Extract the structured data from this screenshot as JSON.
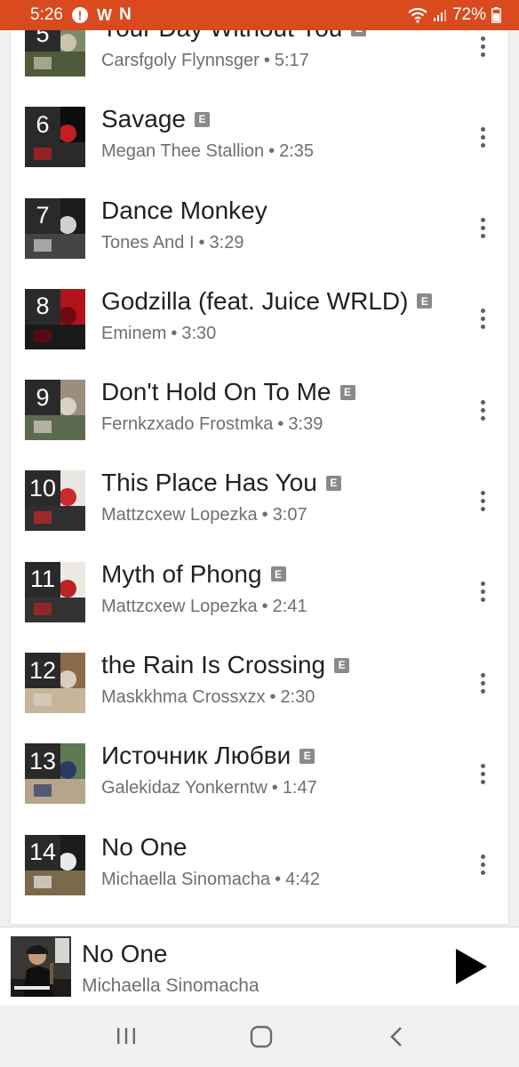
{
  "status_bar": {
    "time": "5:26",
    "battery": "72%",
    "icons": [
      "alert-icon",
      "w-icon",
      "n-icon",
      "wifi-icon",
      "signal-icon",
      "battery-icon"
    ]
  },
  "colors": {
    "status_bar": "#d94a1e",
    "background": "#f1f1f1",
    "card": "#ffffff",
    "explicit_badge": "#8a8a8a"
  },
  "explicit_label": "E",
  "separator": "•",
  "tracks": [
    {
      "number": "5",
      "title": "Your Day Without You",
      "explicit": true,
      "artist": "Carsfgoly Flynnsger",
      "duration": "5:17"
    },
    {
      "number": "6",
      "title": "Savage",
      "explicit": true,
      "artist": "Megan Thee Stallion",
      "duration": "2:35"
    },
    {
      "number": "7",
      "title": "Dance Monkey",
      "explicit": false,
      "artist": "Tones And I",
      "duration": "3:29"
    },
    {
      "number": "8",
      "title": "Godzilla (feat. Juice WRLD)",
      "explicit": true,
      "artist": "Eminem",
      "duration": "3:30"
    },
    {
      "number": "9",
      "title": "Don't Hold On To Me",
      "explicit": true,
      "artist": "Fernkzxado Frostmka",
      "duration": "3:39"
    },
    {
      "number": "10",
      "title": "This Place Has You",
      "explicit": true,
      "artist": "Mattzcxew Lopezka",
      "duration": "3:07"
    },
    {
      "number": "11",
      "title": "Myth of Phong",
      "explicit": true,
      "artist": "Mattzcxew Lopezka",
      "duration": "2:41"
    },
    {
      "number": "12",
      "title": "the Rain Is Crossing",
      "explicit": true,
      "artist": "Maskkhma Crossxzx",
      "duration": "2:30"
    },
    {
      "number": "13",
      "title": "Источник Любви",
      "explicit": true,
      "artist": "Galekidaz Yonkerntw",
      "duration": "1:47"
    },
    {
      "number": "14",
      "title": "No One",
      "explicit": false,
      "artist": "Michaella Sinomacha",
      "duration": "4:42"
    }
  ],
  "now_playing": {
    "title": "No One",
    "artist": "Michaella Sinomacha",
    "control": "play-icon"
  },
  "nav_bar": {
    "buttons": [
      "recents-icon",
      "home-icon",
      "back-icon"
    ]
  }
}
